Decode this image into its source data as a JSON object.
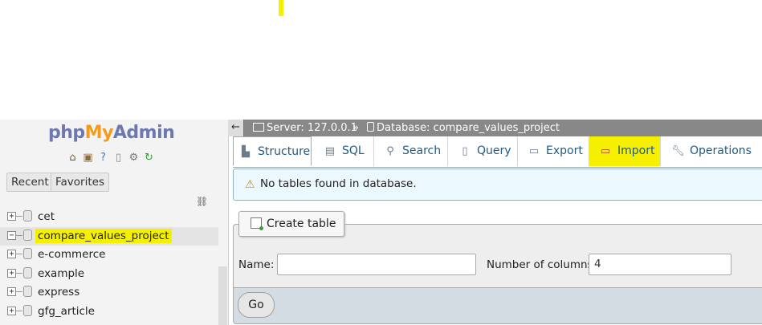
{
  "logo": {
    "part1": "php",
    "part2": "My",
    "part3": "Admin"
  },
  "nav_icons": [
    "home-icon",
    "exit-icon",
    "help-icon",
    "docs-icon",
    "settings-icon",
    "reload-icon"
  ],
  "nav_buttons": {
    "recent": "Recent",
    "favorites": "Favorites"
  },
  "tree": [
    {
      "name": "cet",
      "active": false,
      "expander": "+"
    },
    {
      "name": "compare_values_project",
      "active": true,
      "expander": "−"
    },
    {
      "name": "e-commerce",
      "active": false,
      "expander": "+"
    },
    {
      "name": "example",
      "active": false,
      "expander": "+"
    },
    {
      "name": "express",
      "active": false,
      "expander": "+"
    },
    {
      "name": "gfg_article",
      "active": false,
      "expander": "+"
    }
  ],
  "breadcrumb": {
    "back": "←",
    "server": "Server: 127.0.0.1",
    "sep": "»",
    "database": "Database: compare_values_project"
  },
  "tabs": [
    {
      "label": "Structure",
      "icon": "structure-icon"
    },
    {
      "label": "SQL",
      "icon": "sql-icon"
    },
    {
      "label": "Search",
      "icon": "search-icon"
    },
    {
      "label": "Query",
      "icon": "query-icon"
    },
    {
      "label": "Export",
      "icon": "export-icon"
    },
    {
      "label": "Import",
      "icon": "import-icon"
    },
    {
      "label": "Operations",
      "icon": "wrench-icon"
    }
  ],
  "notice": "No tables found in database.",
  "create_table": {
    "legend": "Create table",
    "name_label": "Name:",
    "name_value": "",
    "columns_label": "Number of columns:",
    "columns_value": "4",
    "go": "Go"
  },
  "colors": {
    "highlight": "#f4f000",
    "link": "#235a81",
    "topbar": "#888888"
  }
}
